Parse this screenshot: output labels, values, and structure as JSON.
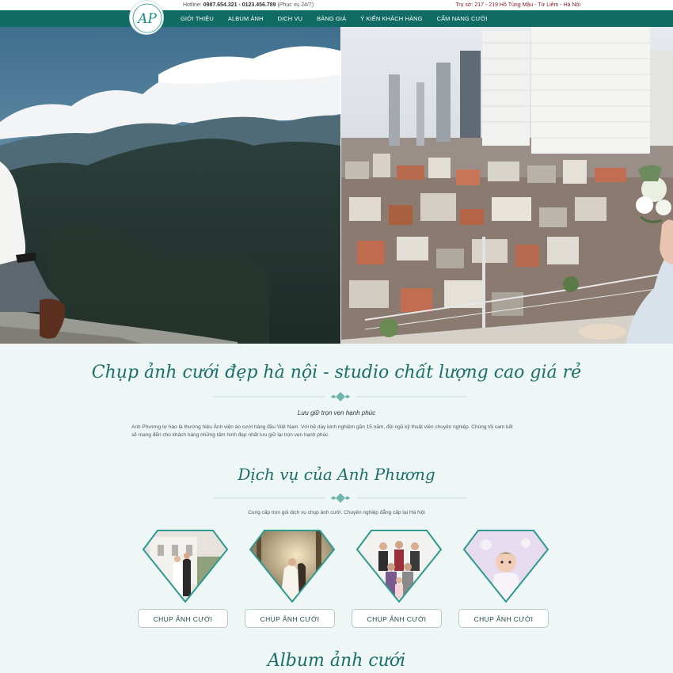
{
  "topbar": {
    "hotline_label": "Hotline: ",
    "hotline_numbers": "0987.654.321 - 0123.456.789",
    "hotline_note": " (Phục vụ 24/7)",
    "address": "Trụ sở: 217 - 219 Hồ Tùng Mậu - Từ Liêm - Hà Nội"
  },
  "logo": {
    "text": "AP"
  },
  "nav": {
    "items": [
      "GIỚI THIỆU",
      "ALBUM ẢNH",
      "DỊCH VỤ",
      "BẢNG GIÁ",
      "Ý KIẾN KHÁCH HÀNG",
      "CẨM NANG CƯỚI"
    ]
  },
  "intro": {
    "title": "Chụp ảnh cưới đẹp hà nội - studio chất lượng cao giá rẻ",
    "subtitle": "Lưu giữ trọn vẹn hạnh phúc",
    "text_line1": "Anh Phương tự hào là thương hiệu Ảnh viện áo cưới hàng đầu Việt Nam. Với bề dày kinh nghiệm gần 15 năm, đội ngũ kỹ thuật viên chuyên nghiệp. Chúng tôi cam kết",
    "text_line2": "sẽ mang đến cho khách hàng những tấm hình đẹp nhất lưu giữ lại trọn vẹn hạnh phúc."
  },
  "services": {
    "title": "Dịch vụ của Anh Phương",
    "description": "Cung cấp trọn gói dịch vụ chụp ảnh cưới. Chuyên nghiệp đẳng cấp tại Hà Nội",
    "items": [
      {
        "button": "CHỤP ẢNH CƯỚI"
      },
      {
        "button": "CHỤP ẢNH CƯỚI"
      },
      {
        "button": "CHỤP ẢNH CƯỚI"
      },
      {
        "button": "CHỤP ẢNH CƯỚI"
      }
    ]
  },
  "album": {
    "title": "Album ảnh cưới"
  },
  "colors": {
    "brand": "#0f6b63",
    "accent": "#1a6f69",
    "address": "#8a1f2e"
  }
}
